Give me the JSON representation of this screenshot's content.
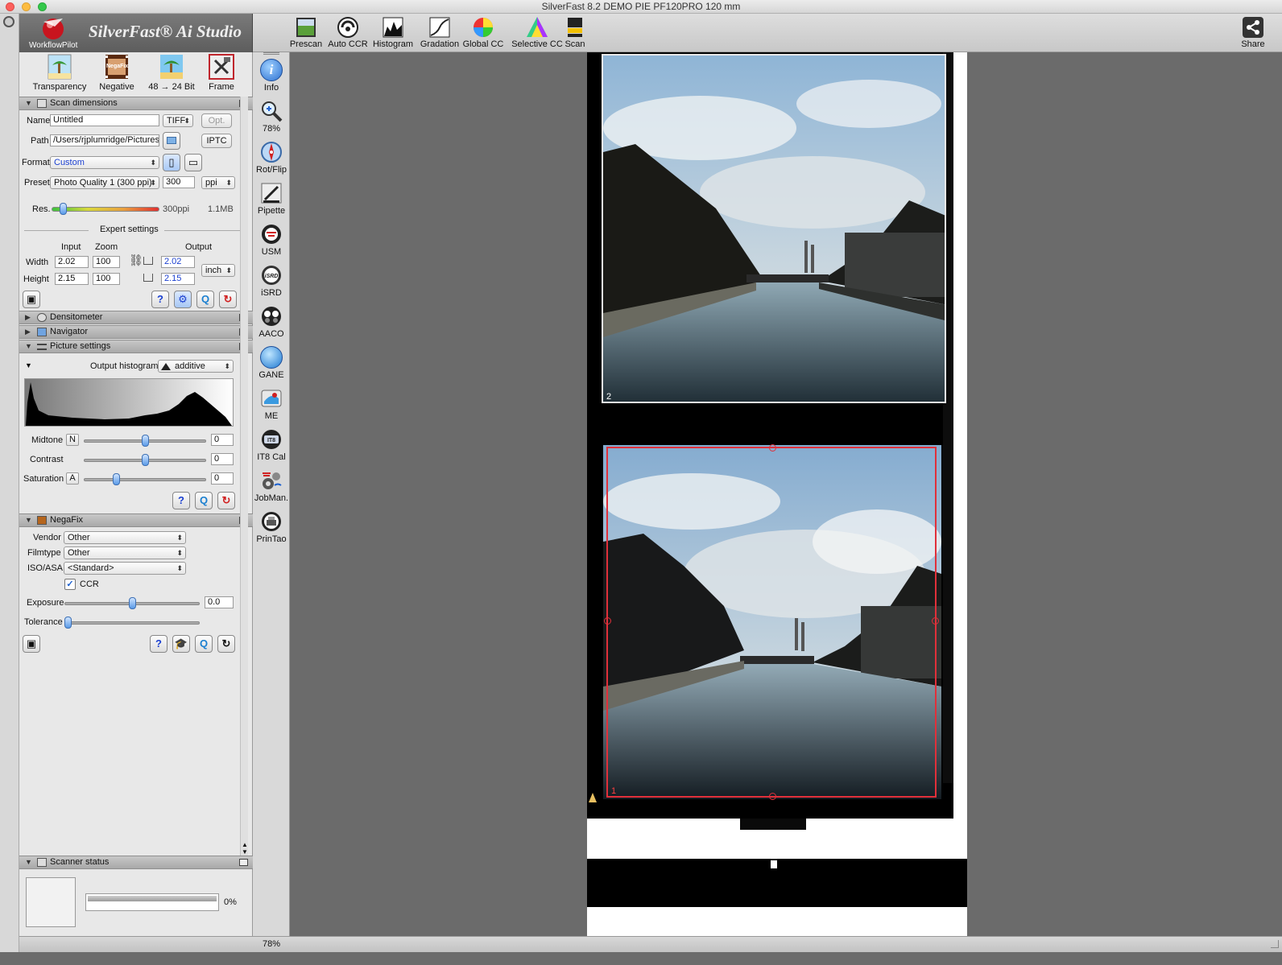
{
  "window": {
    "title": "SilverFast 8.2 DEMO  PIE PF120PRO 120 mm"
  },
  "logo": {
    "workflow_label": "WorkflowPilot",
    "brand_text": "SilverFast® Ai Studio"
  },
  "toolbar": {
    "items": [
      {
        "label": "Prescan",
        "icon": "prescan-icon"
      },
      {
        "label": "Auto CCR",
        "icon": "auto-ccr-icon"
      },
      {
        "label": "Histogram",
        "icon": "histogram-icon"
      },
      {
        "label": "Gradation",
        "icon": "gradation-icon"
      },
      {
        "label": "Global CC",
        "icon": "global-cc-icon"
      },
      {
        "label": "Selective CC",
        "icon": "selective-cc-icon"
      },
      {
        "label": "Scan",
        "icon": "scan-icon"
      }
    ],
    "share_label": "Share"
  },
  "modes": {
    "items": [
      {
        "label": "Transparency"
      },
      {
        "label": "Negative"
      },
      {
        "label": "48 → 24 Bit"
      },
      {
        "label": "Frame"
      }
    ],
    "negative_badge": "NegaFix"
  },
  "scan_dimensions": {
    "title": "Scan dimensions",
    "name_label": "Name",
    "name_value": "Untitled",
    "file_type": "TIFF",
    "opt_label": "Opt.",
    "path_label": "Path",
    "path_value": "/Users/rjplumridge/Pictures",
    "iptc_label": "IPTC",
    "format_label": "Format",
    "format_value": "Custom",
    "preset_label": "Preset",
    "preset_value": "Photo Quality 1 (300 ppi)",
    "ppi_value": "300",
    "ppi_unit": "ppi",
    "res_label": "Res.",
    "res_value": "300ppi",
    "file_size": "1.1MB",
    "res_level": 0.08,
    "expert_settings": "Expert settings",
    "col_input": "Input",
    "col_zoom": "Zoom",
    "col_output": "Output",
    "width_label": "Width",
    "height_label": "Height",
    "width_input": "2.02",
    "width_zoom": "100",
    "width_output": "2.02",
    "height_input": "2.15",
    "height_zoom": "100",
    "height_output": "2.15",
    "unit": "inch"
  },
  "densitometer": {
    "title": "Densitometer"
  },
  "navigator": {
    "title": "Navigator"
  },
  "picture_settings": {
    "title": "Picture settings",
    "output_histogram_label": "Output histogram",
    "histogram_mode": "additive",
    "midtone_label": "Midtone",
    "midtone_btn": "N",
    "midtone_value": "0",
    "midtone_level": 0.5,
    "contrast_label": "Contrast",
    "contrast_value": "0",
    "contrast_level": 0.5,
    "saturation_label": "Saturation",
    "saturation_btn": "A",
    "saturation_value": "0",
    "saturation_level": 0.25
  },
  "negafix": {
    "title": "NegaFix",
    "vendor_label": "Vendor",
    "vendor_value": "Other",
    "filmtype_label": "Filmtype",
    "filmtype_value": "Other",
    "iso_label": "ISO/ASA",
    "iso_value": "<Standard>",
    "ccr_label": "CCR",
    "ccr_checked": true,
    "exposure_label": "Exposure",
    "exposure_value": "0.0",
    "exposure_level": 0.5,
    "tolerance_label": "Tolerance",
    "tolerance_level": 0.0
  },
  "scanner_status": {
    "title": "Scanner status",
    "progress_text": "0%",
    "progress": 0
  },
  "tools": {
    "items": [
      {
        "label": "Info",
        "icon": "info-icon"
      },
      {
        "label": "78%",
        "icon": "zoom-icon"
      },
      {
        "label": "Rot/Flip",
        "icon": "rotate-flip-icon"
      },
      {
        "label": "Pipette",
        "icon": "pipette-icon"
      },
      {
        "label": "USM",
        "icon": "usm-icon"
      },
      {
        "label": "iSRD",
        "icon": "isrd-icon"
      },
      {
        "label": "AACO",
        "icon": "aaco-icon"
      },
      {
        "label": "GANE",
        "icon": "gane-icon"
      },
      {
        "label": "ME",
        "icon": "me-icon"
      },
      {
        "label": "IT8 Cal",
        "icon": "it8-cal-icon"
      },
      {
        "label": "JobMan.",
        "icon": "jobman-icon"
      },
      {
        "label": "PrinTao",
        "icon": "printao-icon"
      }
    ]
  },
  "preview": {
    "frame_top_number": "2",
    "frame_bottom_number": "1"
  },
  "statusbar": {
    "zoom": "78%"
  },
  "colors": {
    "accent_blue": "#3d7fe0",
    "selection_red": "#e0303a",
    "panel_bg": "#e8e8e8",
    "preview_bg": "#6b6b6b"
  }
}
